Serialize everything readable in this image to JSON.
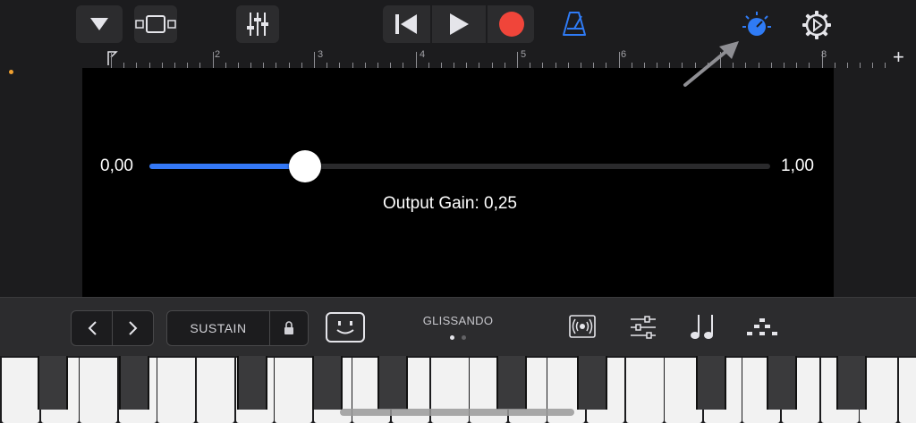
{
  "toolbar": {
    "icons": [
      "dropdown-triangle",
      "track-view",
      "mixer-sliders",
      "rewind",
      "play",
      "record",
      "metronome",
      "master-effects-knob",
      "settings-gear"
    ],
    "accent_color": "#2f7bf5",
    "record_color": "#f0453a",
    "add_label": "+"
  },
  "ruler": {
    "bar_numbers": [
      "2",
      "3",
      "4",
      "5",
      "6",
      "8"
    ]
  },
  "effect_slider": {
    "min_label": "0,00",
    "max_label": "1,00",
    "value": 0.25,
    "caption": "Output Gain: 0,25"
  },
  "controls": {
    "sustain_label": "SUSTAIN",
    "glissando_label": "GLISSANDO",
    "glissando_page": 1,
    "glissando_pages": 2,
    "icons": [
      "chevron-left",
      "chevron-right",
      "lock",
      "smiley",
      "arpeggiator",
      "keyboard-settings",
      "notes",
      "scale"
    ]
  }
}
